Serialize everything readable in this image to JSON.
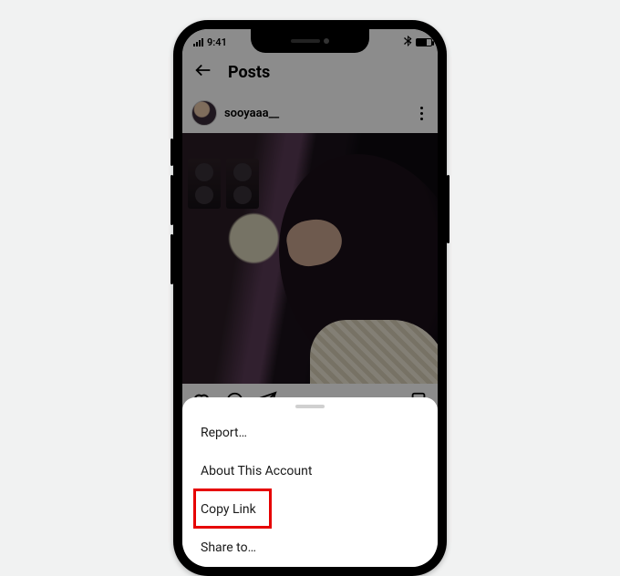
{
  "status": {
    "time": "9:41"
  },
  "header": {
    "title": "Posts"
  },
  "post": {
    "username": "sooyaaa__"
  },
  "sheet": {
    "items": [
      {
        "label": "Report…"
      },
      {
        "label": "About This Account"
      },
      {
        "label": "Copy Link"
      },
      {
        "label": "Share to…"
      }
    ]
  },
  "highlight_index": 2
}
